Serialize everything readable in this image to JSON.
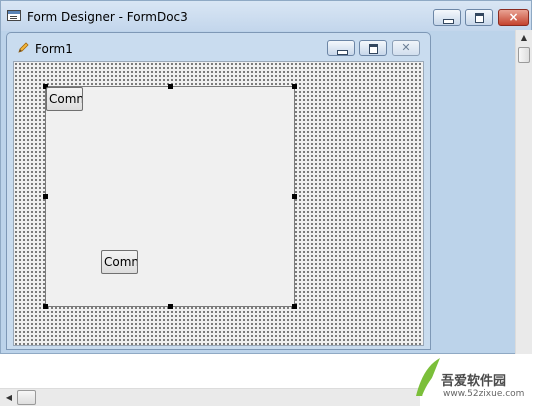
{
  "designer_window": {
    "title": "Form Designer - FormDoc3",
    "icon": "form-designer-icon",
    "buttons": {
      "minimize": "minimize-icon",
      "maximize": "maximize-icon",
      "close": "×"
    }
  },
  "form_window": {
    "title": "Form1",
    "icon": "pencil-icon",
    "buttons": {
      "minimize": "minimize-icon",
      "maximize": "maximize-icon",
      "close": "✕"
    }
  },
  "controls": {
    "command1_label": "Comn",
    "command2_label": "Comn"
  },
  "watermark": {
    "text": "吾爱软件园",
    "url": "www.52zixue.com"
  },
  "colors": {
    "titlebar": "#c3d6ec",
    "close_red": "#c4432e",
    "form_surface": "#f0f0f0",
    "grid_dot": "#111111"
  }
}
